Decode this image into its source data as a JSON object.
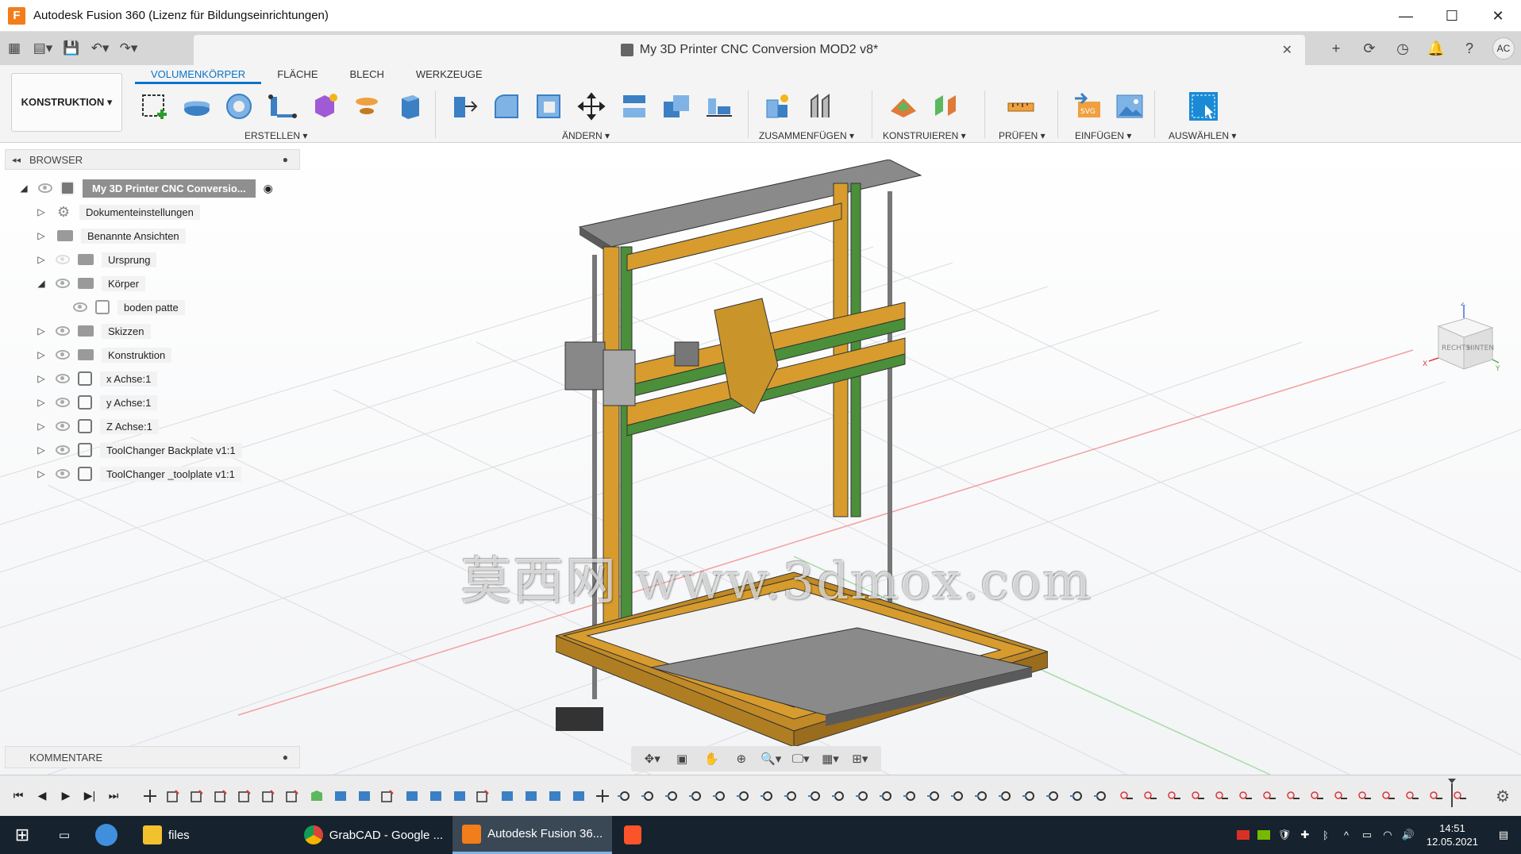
{
  "window": {
    "title": "Autodesk Fusion 360 (Lizenz für Bildungseinrichtungen)",
    "app_icon": "F"
  },
  "doc_tab": {
    "title": "My 3D Printer CNC Conversion MOD2 v8*",
    "user_initials": "AC"
  },
  "workspace": {
    "label": "KONSTRUKTION ▾"
  },
  "ribbon": {
    "tabs": [
      {
        "label": "VOLUMENKÖRPER",
        "active": true
      },
      {
        "label": "FLÄCHE"
      },
      {
        "label": "BLECH"
      },
      {
        "label": "WERKZEUGE"
      }
    ],
    "groups": {
      "erstellen": "ERSTELLEN ▾",
      "aendern": "ÄNDERN ▾",
      "zusammenfuegen": "ZUSAMMENFÜGEN ▾",
      "konstruieren": "KONSTRUIEREN ▾",
      "pruefen": "PRÜFEN ▾",
      "einfuegen": "EINFÜGEN ▾",
      "auswaehlen": "AUSWÄHLEN ▾"
    }
  },
  "browser": {
    "header": "BROWSER",
    "root": "My 3D Printer CNC Conversio...",
    "items": [
      {
        "label": "Dokumenteinstellungen",
        "icon": "gear-icon"
      },
      {
        "label": "Benannte Ansichten",
        "icon": "folder-icon"
      },
      {
        "label": "Ursprung",
        "icon": "folder-icon"
      },
      {
        "label": "Körper",
        "icon": "folder-icon"
      },
      {
        "label": "boden patte",
        "icon": "body-icon"
      },
      {
        "label": "Skizzen",
        "icon": "folder-icon"
      },
      {
        "label": "Konstruktion",
        "icon": "folder-icon"
      },
      {
        "label": "x Achse:1",
        "icon": "component-icon"
      },
      {
        "label": "y Achse:1",
        "icon": "component-icon"
      },
      {
        "label": "Z Achse:1",
        "icon": "component-icon"
      },
      {
        "label": "ToolChanger Backplate v1:1",
        "icon": "component-icon"
      },
      {
        "label": "ToolChanger _toolplate v1:1",
        "icon": "component-icon"
      }
    ]
  },
  "comments": {
    "header": "KOMMENTARE"
  },
  "viewcube": {
    "left": "RECHTS",
    "right": "HINTEN",
    "z": "Z",
    "x": "X",
    "y": "Y"
  },
  "watermark": "莫西网 www.3dmox.com",
  "taskbar": {
    "apps": [
      {
        "label": "files"
      },
      {
        "label": "GrabCAD - Google ..."
      },
      {
        "label": "Autodesk Fusion 36..."
      }
    ],
    "time": "14:51",
    "date": "12.05.2021"
  },
  "colors": {
    "accent": "#0a74c8",
    "frame_orange": "#d79c2d",
    "frame_green": "#4b8f3a",
    "plate_gray": "#8a8a8a"
  }
}
